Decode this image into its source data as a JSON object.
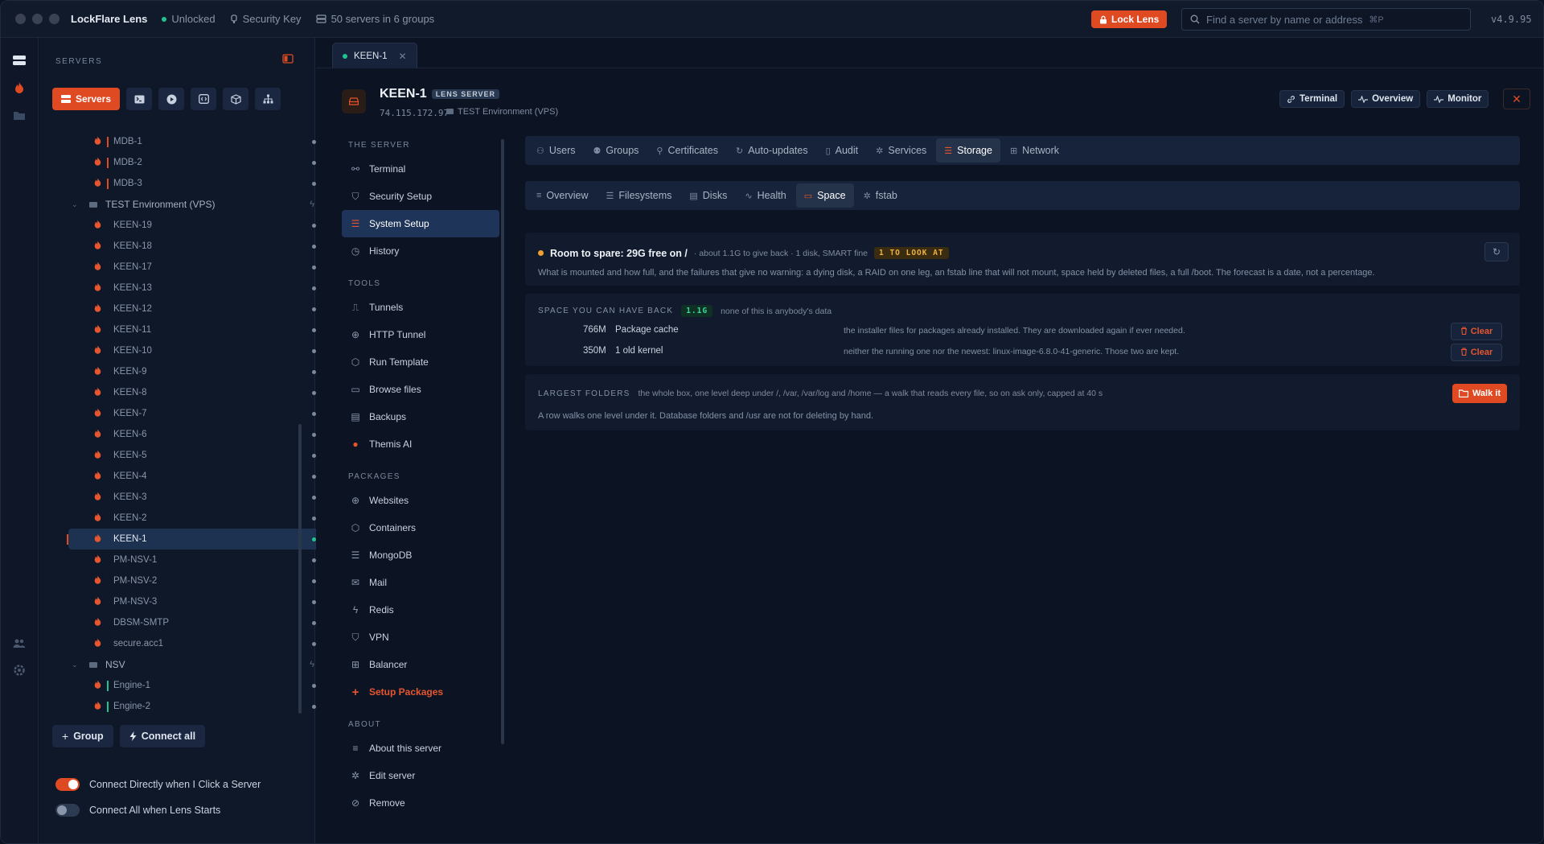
{
  "titlebar": {
    "app_name": "LockFlare Lens",
    "unlock_status": "Unlocked",
    "key_label": "Security Key",
    "servers_summary": "50 servers in 6 groups",
    "lock_button": "Lock Lens",
    "search_placeholder": "Find a server by name or address",
    "search_shortcut": "⌘P",
    "version": "v4.9.95"
  },
  "sidebar": {
    "heading": "SERVERS",
    "servers_button": "Servers",
    "tree": [
      {
        "label": "MDB-1",
        "type": "server",
        "bar": "#e04a23"
      },
      {
        "label": "MDB-2",
        "type": "server",
        "bar": "#e04a23"
      },
      {
        "label": "MDB-3",
        "type": "server",
        "bar": "#e04a23"
      },
      {
        "label": "TEST Environment (VPS)",
        "type": "group"
      },
      {
        "label": "KEEN-19",
        "type": "server"
      },
      {
        "label": "KEEN-18",
        "type": "server"
      },
      {
        "label": "KEEN-17",
        "type": "server"
      },
      {
        "label": "KEEN-13",
        "type": "server"
      },
      {
        "label": "KEEN-12",
        "type": "server"
      },
      {
        "label": "KEEN-11",
        "type": "server"
      },
      {
        "label": "KEEN-10",
        "type": "server"
      },
      {
        "label": "KEEN-9",
        "type": "server"
      },
      {
        "label": "KEEN-8",
        "type": "server"
      },
      {
        "label": "KEEN-7",
        "type": "server"
      },
      {
        "label": "KEEN-6",
        "type": "server"
      },
      {
        "label": "KEEN-5",
        "type": "server"
      },
      {
        "label": "KEEN-4",
        "type": "server"
      },
      {
        "label": "KEEN-3",
        "type": "server"
      },
      {
        "label": "KEEN-2",
        "type": "server"
      },
      {
        "label": "KEEN-1",
        "type": "server",
        "selected": true
      },
      {
        "label": "PM-NSV-1",
        "type": "server"
      },
      {
        "label": "PM-NSV-2",
        "type": "server"
      },
      {
        "label": "PM-NSV-3",
        "type": "server"
      },
      {
        "label": "DBSM-SMTP",
        "type": "server"
      },
      {
        "label": "secure.acc1",
        "type": "server"
      },
      {
        "label": "NSV",
        "type": "group"
      },
      {
        "label": "Engine-1",
        "type": "server",
        "bar": "#22c38e"
      },
      {
        "label": "Engine-2",
        "type": "server",
        "bar": "#22c38e"
      }
    ],
    "add_group": "Group",
    "connect_all": "Connect all",
    "toggle_direct": "Connect Directly when I Click a Server",
    "toggle_start": "Connect All when Lens Starts"
  },
  "tab": {
    "label": "KEEN-1"
  },
  "server": {
    "name": "KEEN-1",
    "badge": "LENS SERVER",
    "ip": "74.115.172.97",
    "environment": "TEST Environment (VPS)",
    "btn_terminal": "Terminal",
    "btn_overview": "Overview",
    "btn_monitor": "Monitor"
  },
  "nav": {
    "sec_server": "THE SERVER",
    "terminal": "Terminal",
    "security_setup": "Security Setup",
    "system_setup": "System Setup",
    "history": "History",
    "sec_tools": "TOOLS",
    "tunnels": "Tunnels",
    "http_tunnel": "HTTP Tunnel",
    "run_template": "Run Template",
    "browse_files": "Browse files",
    "backups": "Backups",
    "themis_ai": "Themis AI",
    "sec_packages": "PACKAGES",
    "websites": "Websites",
    "containers": "Containers",
    "mongodb": "MongoDB",
    "mail": "Mail",
    "redis": "Redis",
    "vpn": "VPN",
    "balancer": "Balancer",
    "setup_packages": "Setup Packages",
    "sec_about": "ABOUT",
    "about_server": "About this server",
    "edit_server": "Edit server",
    "remove": "Remove"
  },
  "tabs_top": [
    "Users",
    "Groups",
    "Certificates",
    "Auto-updates",
    "Audit",
    "Services",
    "Storage",
    "Network"
  ],
  "tabs_sub": [
    "Overview",
    "Filesystems",
    "Disks",
    "Health",
    "Space",
    "fstab"
  ],
  "status": {
    "title": "Room to spare: 29G free on /",
    "sub": "· about 1.1G to give back · 1 disk, SMART fine",
    "pill": "1 TO LOOK AT",
    "description": "What is mounted and how full, and the failures that give no warning: a dying disk, a RAID on one leg, an fstab line that will not mount, space held by deleted files, a full /boot. The forecast is a date, not a percentage."
  },
  "reclaim": {
    "heading": "SPACE YOU CAN HAVE BACK",
    "total": "1.1G",
    "note": "none of this is anybody's data",
    "rows": [
      {
        "size": "766M",
        "name": "Package cache",
        "desc": "the installer files for packages already installed. They are downloaded again if ever needed.",
        "action": "Clear"
      },
      {
        "size": "350M",
        "name": "1 old kernel",
        "desc": "neither the running one nor the newest: linux-image-6.8.0-41-generic. Those two are kept.",
        "action": "Clear"
      }
    ]
  },
  "folders": {
    "heading": "LARGEST FOLDERS",
    "note": "the whole box, one level deep under /, /var, /var/log and /home — a walk that reads every file, so on ask only, capped at 40 s",
    "action": "Walk it",
    "footer": "A row walks one level under it. Database folders and /usr are not for deleting by hand."
  }
}
